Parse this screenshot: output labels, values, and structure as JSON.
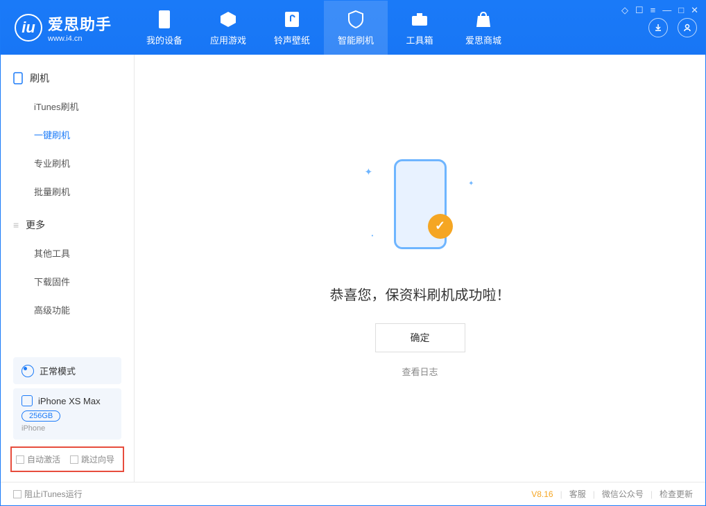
{
  "app": {
    "title": "爱思助手",
    "subtitle": "www.i4.cn"
  },
  "nav": [
    {
      "label": "我的设备"
    },
    {
      "label": "应用游戏"
    },
    {
      "label": "铃声壁纸"
    },
    {
      "label": "智能刷机"
    },
    {
      "label": "工具箱"
    },
    {
      "label": "爱思商城"
    }
  ],
  "sidebar": {
    "section1": {
      "title": "刷机",
      "items": [
        "iTunes刷机",
        "一键刷机",
        "专业刷机",
        "批量刷机"
      ]
    },
    "section2": {
      "title": "更多",
      "items": [
        "其他工具",
        "下载固件",
        "高级功能"
      ]
    },
    "mode_label": "正常模式",
    "device": {
      "name": "iPhone XS Max",
      "storage": "256GB",
      "type": "iPhone"
    },
    "checkboxes": {
      "auto_activate": "自动激活",
      "skip_guide": "跳过向导"
    }
  },
  "main": {
    "success_msg": "恭喜您，保资料刷机成功啦！",
    "confirm_btn": "确定",
    "view_log": "查看日志"
  },
  "footer": {
    "block_itunes": "阻止iTunes运行",
    "version": "V8.16",
    "links": [
      "客服",
      "微信公众号",
      "检查更新"
    ]
  }
}
